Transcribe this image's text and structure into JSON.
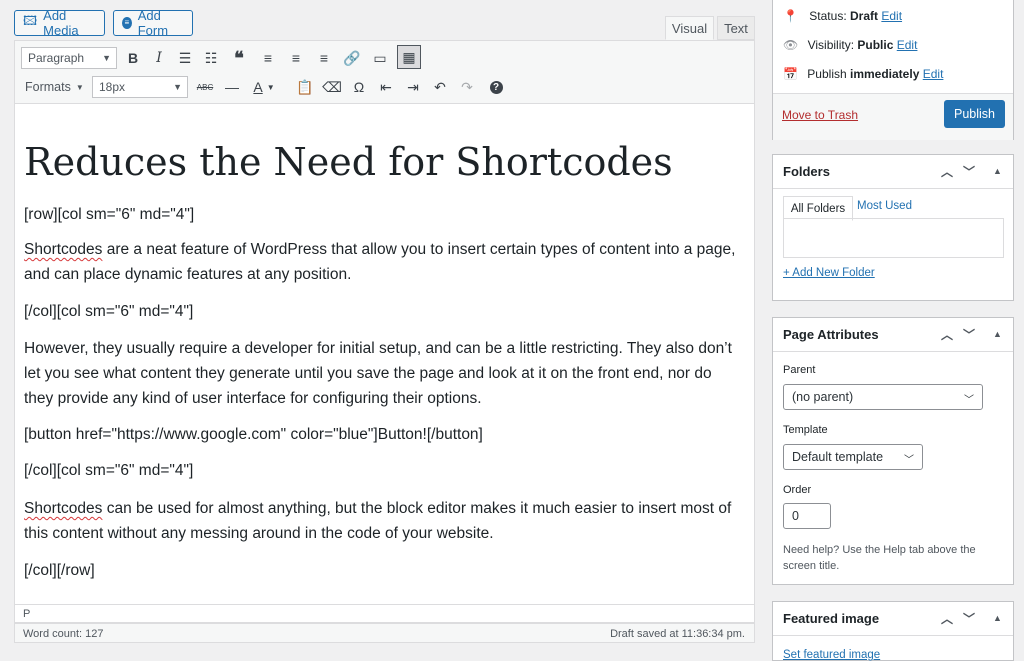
{
  "media": {
    "add_media": "Add Media",
    "add_form": "Add Form"
  },
  "mode_tabs": {
    "visual": "Visual",
    "text": "Text"
  },
  "toolbar": {
    "paragraph_select": "Paragraph",
    "formats_menu": "Formats",
    "font_size": "18px"
  },
  "content": {
    "heading": "Reduces the Need for Shortcodes",
    "p1": "[row][col sm=\"6\" md=\"4\"]",
    "p2_word": "Shortcodes",
    "p2_rest": " are a neat feature of WordPress that allow you to insert certain types of content into a page, and can place dynamic features at any position.",
    "p3": "[/col][col sm=\"6\" md=\"4\"]",
    "p4": "However, they usually require a developer for initial setup, and can be a little restricting. They also don’t let you see what content they generate until you save the page and look at it on the front end, nor do they provide any kind of user interface for configuring their options.",
    "p5": "[button href=\"https://www.google.com\" color=\"blue\"]Button![/button]",
    "p6": "[/col][col sm=\"6\" md=\"4\"]",
    "p7_word": "Shortcodes",
    "p7_rest": " can be used for almost anything, but the block editor makes it much easier to insert most of this content without any messing around in the code of your website.",
    "p8": "[/col][/row]"
  },
  "status_path": "P",
  "word_count": "Word count: 127",
  "draft_saved": "Draft saved at 11:36:34 pm.",
  "publish": {
    "status_label": "Status:",
    "status_value": "Draft",
    "status_edit": "Edit",
    "visibility_label": "Visibility:",
    "visibility_value": "Public",
    "visibility_edit": "Edit",
    "publish_label": "Publish",
    "publish_value": "immediately",
    "publish_edit": "Edit",
    "trash": "Move to Trash",
    "publish_button": "Publish"
  },
  "folders": {
    "title": "Folders",
    "tab_all": "All Folders",
    "tab_most": "Most Used",
    "add_new": "+ Add New Folder"
  },
  "page_attributes": {
    "title": "Page Attributes",
    "parent_label": "Parent",
    "parent_value": "(no parent)",
    "template_label": "Template",
    "template_value": "Default template",
    "order_label": "Order",
    "order_value": "0",
    "help": "Need help? Use the Help tab above the screen title."
  },
  "featured": {
    "title": "Featured image",
    "set_link": "Set featured image"
  },
  "colors": {
    "accent": "#2271b1",
    "danger": "#b32d2e"
  }
}
